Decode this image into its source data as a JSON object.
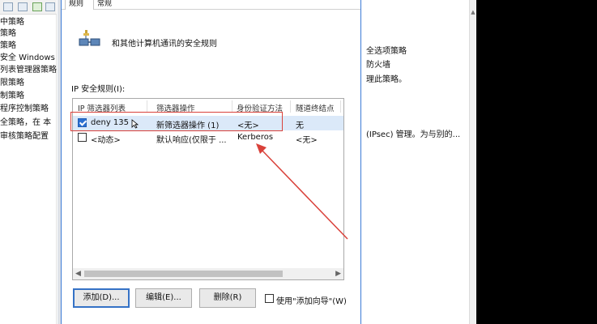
{
  "left_tree": {
    "items": [
      "中策略",
      "策略",
      "安全 Windows",
      "列表管理器策略",
      "限策略",
      "制策略",
      "程序控制策略",
      "全策略，在 本",
      "审核策略配置"
    ]
  },
  "dialog": {
    "tabs": [
      "规则",
      "常规"
    ],
    "header_text": "和其他计算机通讯的安全规则",
    "rules_label": "IP 安全规则(I):",
    "columns": [
      "IP 筛选器列表",
      "筛选器操作",
      "身份验证方法",
      "隧道终结点"
    ],
    "rows": [
      {
        "checked": true,
        "filter_list": "deny 135",
        "filter_action": "新筛选器操作 (1)",
        "auth": "<无>",
        "tunnel": "无"
      },
      {
        "checked": false,
        "filter_list": "<动态>",
        "filter_action": "默认响应(仅限于 ...",
        "auth": "Kerberos",
        "tunnel": "<无>"
      }
    ],
    "buttons": {
      "add": "添加(D)...",
      "edit": "编辑(E)...",
      "remove": "删除(R)"
    },
    "wizard_label": "使用\"添加向导\"(W)"
  },
  "right_panel": {
    "lines": [
      "全选项策略",
      "防火墙",
      "理此策略。",
      "(IPsec) 管理。为与别的..."
    ]
  },
  "colors": {
    "highlight_red": "#d9413a",
    "selection_blue": "#dbe9f9",
    "accent_blue": "#3c7bd6"
  }
}
